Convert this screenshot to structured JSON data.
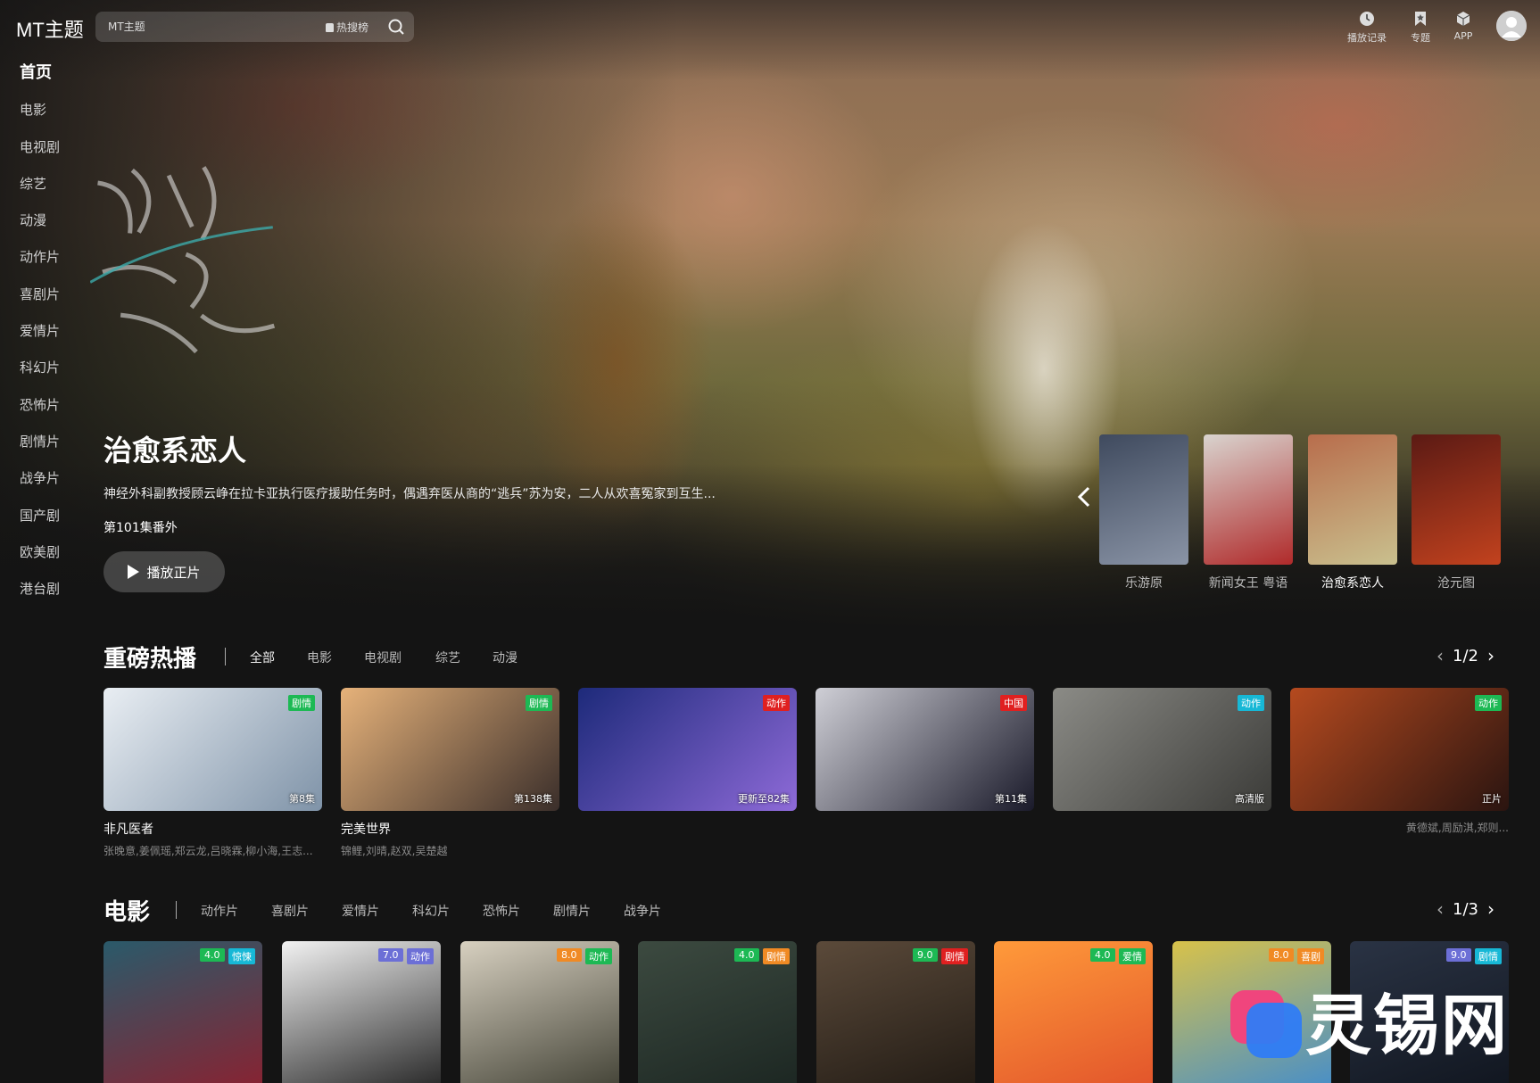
{
  "header": {
    "logo": "MT主题",
    "search_placeholder": "MT主题",
    "hot_search_label": "热搜榜",
    "actions": [
      {
        "label": "播放记录",
        "icon": "clock-icon"
      },
      {
        "label": "专题",
        "icon": "bookmark-icon"
      },
      {
        "label": "APP",
        "icon": "cube-icon"
      }
    ]
  },
  "sidebar": {
    "items": [
      {
        "label": "首页"
      },
      {
        "label": "电影"
      },
      {
        "label": "电视剧"
      },
      {
        "label": "综艺"
      },
      {
        "label": "动漫"
      },
      {
        "label": "动作片"
      },
      {
        "label": "喜剧片"
      },
      {
        "label": "爱情片"
      },
      {
        "label": "科幻片"
      },
      {
        "label": "恐怖片"
      },
      {
        "label": "剧情片"
      },
      {
        "label": "战争片"
      },
      {
        "label": "国产剧"
      },
      {
        "label": "欧美剧"
      },
      {
        "label": "港台剧"
      }
    ]
  },
  "hero": {
    "title": "治愈系恋人",
    "description": "神经外科副教授顾云峥在拉卡亚执行医疗援助任务时，偶遇弃医从商的“逃兵”苏为安，二人从欢喜冤家到互生...",
    "episode": "第101集番外",
    "play_label": "播放正片",
    "thumbs": [
      {
        "label": "乐游原",
        "color_a": "#3f4a5e",
        "color_b": "#8a94a6"
      },
      {
        "label": "新闻女王 粤语",
        "color_a": "#d9d4cf",
        "color_b": "#b02a2a"
      },
      {
        "label": "治愈系恋人",
        "color_a": "#b86d4c",
        "color_b": "#c9c08e"
      },
      {
        "label": "沧元图",
        "color_a": "#5b1a14",
        "color_b": "#c2421e"
      }
    ]
  },
  "hot": {
    "title": "重磅热播",
    "tabs": [
      "全部",
      "电影",
      "电视剧",
      "综艺",
      "动漫"
    ],
    "page": "1/2",
    "cards": [
      {
        "title": "非凡医者",
        "sub": "张晚意,姜佩瑶,郑云龙,吕晓霖,柳小海,王志...",
        "badge": "剧情",
        "badge_color": "#1db954",
        "ep": "第8集",
        "color_a": "#e9eef3",
        "color_b": "#7f93a8"
      },
      {
        "title": "完美世界",
        "sub": "锦鲤,刘晴,赵双,吴楚越",
        "badge": "剧情",
        "badge_color": "#1db954",
        "ep": "第138集",
        "color_a": "#e6b27a",
        "color_b": "#3a2e2a"
      },
      {
        "title": "",
        "sub": "",
        "badge": "动作",
        "badge_color": "#e02020",
        "ep": "更新至82集",
        "color_a": "#1d2a7a",
        "color_b": "#8e6ad8"
      },
      {
        "title": "",
        "sub": "",
        "badge": "中国",
        "badge_color": "#e02020",
        "ep": "第11集",
        "color_a": "#cfcfd6",
        "color_b": "#1a1a2a"
      },
      {
        "title": "",
        "sub": "",
        "badge": "动作",
        "badge_color": "#17b8d6",
        "ep": "高清版",
        "color_a": "#8b8b86",
        "color_b": "#3b3b38"
      },
      {
        "title": "",
        "sub": "黄德斌,周励淇,郑则...",
        "badge": "动作",
        "badge_color": "#1db954",
        "ep": "正片",
        "color_a": "#b54a1f",
        "color_b": "#2a1410"
      }
    ]
  },
  "movies": {
    "title": "电影",
    "tabs": [
      "动作片",
      "喜剧片",
      "爱情片",
      "科幻片",
      "恐怖片",
      "剧情片",
      "战争片"
    ],
    "page": "1/3",
    "posters": [
      {
        "score": "4.0",
        "genre": "惊悚",
        "score_color": "#1db954",
        "genre_color": "#17b8d6",
        "color_a": "#2a5a6a",
        "color_b": "#8e1f2e"
      },
      {
        "score": "7.0",
        "genre": "动作",
        "score_color": "#6c6fd6",
        "genre_color": "#6c6fd6",
        "color_a": "#f2f2f2",
        "color_b": "#1a1a1a"
      },
      {
        "score": "8.0",
        "genre": "动作",
        "score_color": "#f08a24",
        "genre_color": "#1db954",
        "color_a": "#d7d0c0",
        "color_b": "#3a3a2e"
      },
      {
        "score": "4.0",
        "genre": "剧情",
        "score_color": "#1db954",
        "genre_color": "#f08a24",
        "color_a": "#3c4a40",
        "color_b": "#1a2420"
      },
      {
        "score": "9.0",
        "genre": "剧情",
        "score_color": "#1db954",
        "genre_color": "#e02020",
        "color_a": "#5b4a3a",
        "color_b": "#1e1812"
      },
      {
        "score": "4.0",
        "genre": "爱情",
        "score_color": "#1db954",
        "genre_color": "#1db954",
        "color_a": "#ff9a3a",
        "color_b": "#e0502a"
      },
      {
        "score": "8.0",
        "genre": "喜剧",
        "score_color": "#f08a24",
        "genre_color": "#f08a24",
        "color_a": "#d8c24a",
        "color_b": "#3e8bd0"
      },
      {
        "score": "9.0",
        "genre": "剧情",
        "score_color": "#6c6fd6",
        "genre_color": "#17b8d6",
        "color_a": "#2a3344",
        "color_b": "#0f141d"
      }
    ]
  },
  "watermark": {
    "text": "灵锡网"
  }
}
